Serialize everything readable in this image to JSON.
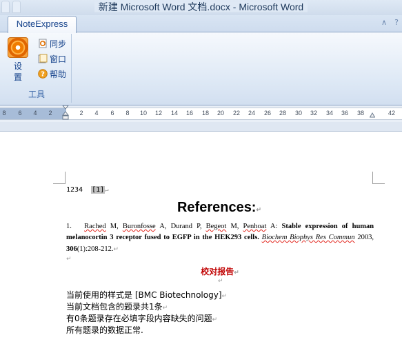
{
  "window": {
    "title": "新建 Microsoft Word 文档.docx  -  Microsoft Word",
    "ghost_tabs": [
      "",
      "",
      ""
    ]
  },
  "ribbon": {
    "active_tab": "NoteExpress",
    "group": {
      "label": "工具",
      "settings_label": "设置",
      "sync_label": "同步",
      "window_label": "窗口",
      "help_label": "帮助"
    }
  },
  "ruler": {
    "ticks_left": [
      "8",
      "6",
      "4",
      "2"
    ],
    "ticks_right": [
      "2",
      "4",
      "6",
      "8",
      "10",
      "12",
      "14",
      "16",
      "18",
      "20",
      "22",
      "24",
      "26",
      "28",
      "30",
      "32",
      "34",
      "36",
      "38",
      "42"
    ]
  },
  "document": {
    "citation_text": "1234",
    "citation_ref": "[1]",
    "paragraph_mark": "↵",
    "references_heading": "References:",
    "reference": {
      "number": "1.",
      "authors": [
        "Rached",
        "M,",
        "Buronfosse",
        "A,",
        "Durand",
        "P,",
        "Begeot",
        "M,",
        "Penhoat",
        "A:"
      ],
      "title": "Stable expression of human melanocortin 3 receptor fused to EGFP in the HEK293 cells.",
      "journal": "Biochem Biophys Res Commun",
      "year": "2003,",
      "volume": "306",
      "issue_pages": "(1):208-212."
    },
    "report": {
      "title": "校对报告",
      "lines": [
        "当前使用的样式是 [BMC Biotechnology]",
        "当前文档包含的题录共1条",
        "有0条题录存在必填字段内容缺失的问题",
        "所有题录的数据正常."
      ]
    }
  }
}
